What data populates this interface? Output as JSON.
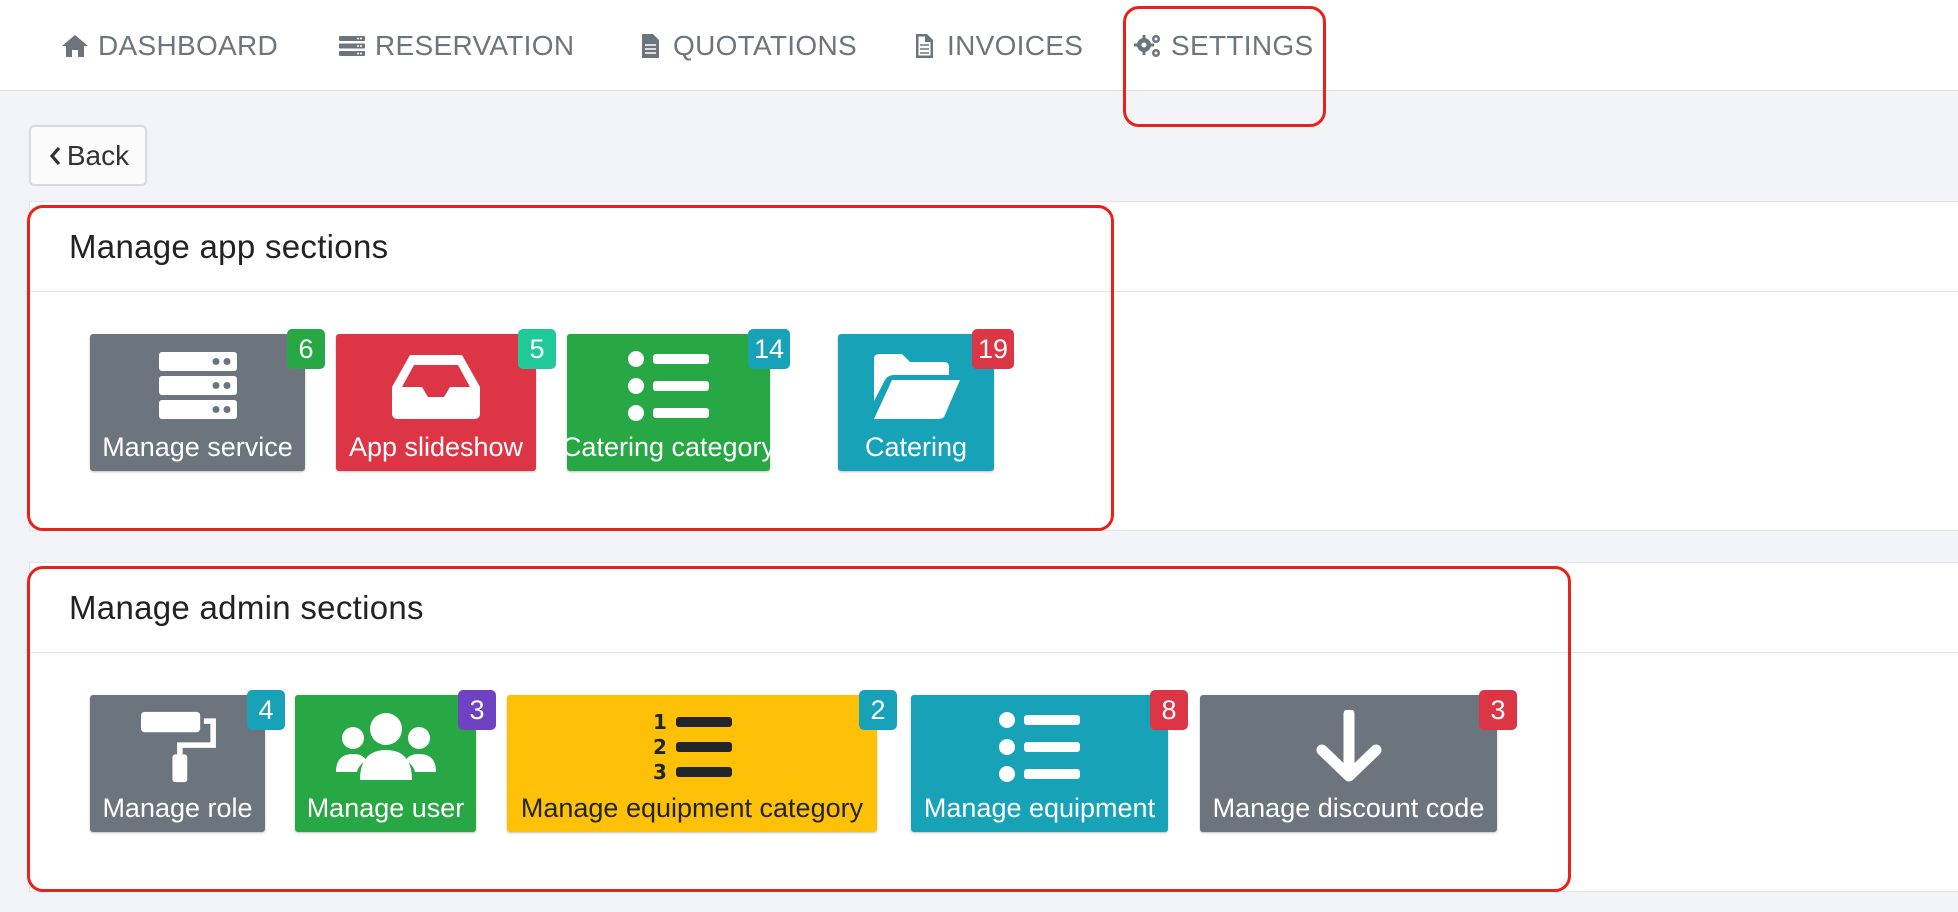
{
  "nav": {
    "items": [
      {
        "label": "DASHBOARD",
        "icon": "home-icon"
      },
      {
        "label": "RESERVATION",
        "icon": "server-icon"
      },
      {
        "label": "QUOTATIONS",
        "icon": "file-icon"
      },
      {
        "label": "INVOICES",
        "icon": "file-text-icon"
      },
      {
        "label": "SETTINGS",
        "icon": "gears-icon"
      }
    ]
  },
  "back_button": {
    "label": "Back",
    "icon": "chevron-left-icon"
  },
  "app_sections": {
    "title": "Manage app sections",
    "tiles": [
      {
        "label": "Manage service",
        "count": "6",
        "color": "#6c757d",
        "badge_color": "#28a745",
        "icon": "server-icon"
      },
      {
        "label": "App slideshow",
        "count": "5",
        "color": "#dc3545",
        "badge_color": "#20c997",
        "icon": "inbox-icon"
      },
      {
        "label": "Catering category",
        "count": "14",
        "color": "#28a745",
        "badge_color": "#17a2b8",
        "icon": "list-icon"
      },
      {
        "label": "Catering",
        "count": "19",
        "color": "#17a2b8",
        "badge_color": "#dc3545",
        "icon": "folder-open-icon"
      }
    ]
  },
  "admin_sections": {
    "title": "Manage admin sections",
    "tiles": [
      {
        "label": "Manage role",
        "count": "4",
        "color": "#6c757d",
        "badge_color": "#17a2b8",
        "icon": "paint-roller-icon"
      },
      {
        "label": "Manage user",
        "count": "3",
        "color": "#28a745",
        "badge_color": "#6f42c1",
        "icon": "users-icon"
      },
      {
        "label": "Manage equipment category",
        "count": "2",
        "color": "#ffc107",
        "badge_color": "#17a2b8",
        "icon": "list-ol-icon"
      },
      {
        "label": "Manage equipment",
        "count": "8",
        "color": "#17a2b8",
        "badge_color": "#dc3545",
        "icon": "list-icon"
      },
      {
        "label": "Manage discount code",
        "count": "3",
        "color": "#6c757d",
        "badge_color": "#dc3545",
        "icon": "arrow-down-icon"
      }
    ]
  }
}
